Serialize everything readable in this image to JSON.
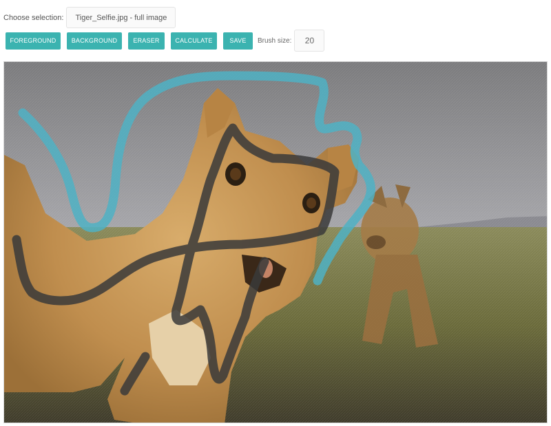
{
  "selection": {
    "label": "Choose selection:",
    "value": "Tiger_Selfie.jpg - full image"
  },
  "toolbar": {
    "buttons": [
      "FOREGROUND",
      "BACKGROUND",
      "ERASER",
      "CALCULATE",
      "SAVE"
    ],
    "brush_label": "Brush size:",
    "brush_value": "20"
  },
  "colors": {
    "accent": "#3bb3b0",
    "foreground_stroke": "#4fb2c4",
    "background_stroke": "#3a3a3a"
  },
  "canvas": {
    "image_description_icon": "photo-canvas"
  }
}
